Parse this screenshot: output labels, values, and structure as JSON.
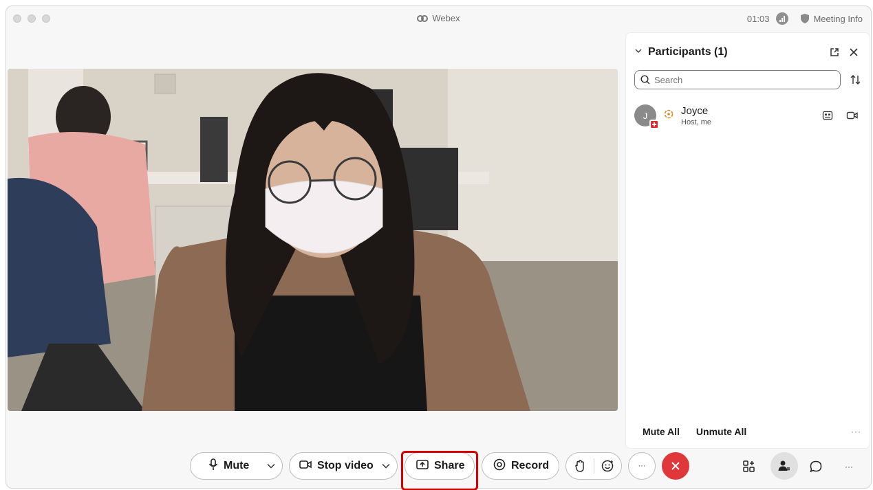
{
  "window": {
    "app_title": "Webex",
    "timer": "01:03",
    "meeting_info_label": "Meeting Info"
  },
  "participants": {
    "title": "Participants (1)",
    "search_placeholder": "Search",
    "list": [
      {
        "initial": "J",
        "name": "Joyce",
        "role": "Host, me"
      }
    ],
    "mute_all": "Mute All",
    "unmute_all": "Unmute All",
    "more": "···"
  },
  "controls": {
    "mute": "Mute",
    "stop_video": "Stop video",
    "share": "Share",
    "record": "Record",
    "more": "···"
  },
  "colors": {
    "end_call": "#e0383a",
    "highlight": "#d80000"
  }
}
